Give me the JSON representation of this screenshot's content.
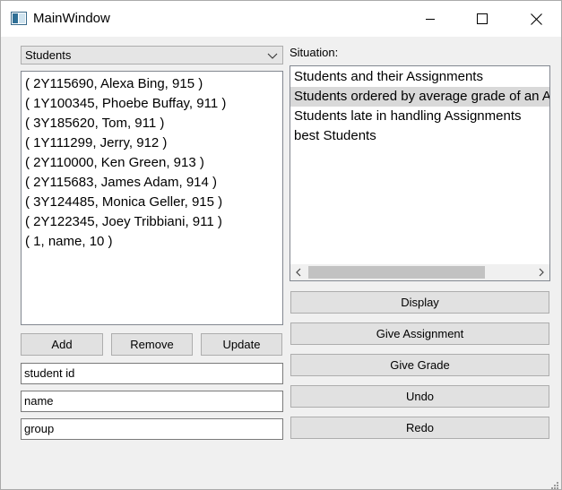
{
  "window": {
    "title": "MainWindow"
  },
  "combo": {
    "selected": "Students"
  },
  "students": [
    "( 2Y115690, Alexa Bing, 915 )",
    "( 1Y100345, Phoebe Buffay, 911 )",
    "( 3Y185620, Tom, 911 )",
    "( 1Y111299, Jerry, 912 )",
    "( 2Y110000, Ken Green, 913 )",
    "( 2Y115683, James Adam, 914 )",
    "( 3Y124485, Monica Geller, 915 )",
    "( 2Y122345, Joey Tribbiani, 911 )",
    "( 1, name, 10 )"
  ],
  "buttons": {
    "add": "Add",
    "remove": "Remove",
    "update": "Update",
    "display": "Display",
    "give_assignment": "Give Assignment",
    "give_grade": "Give Grade",
    "undo": "Undo",
    "redo": "Redo"
  },
  "fields": {
    "student_id": "student id",
    "name": "name",
    "group": "group"
  },
  "situation": {
    "label": "Situation:",
    "items": [
      "Students and their Assignments",
      "Students ordered by average grade of an Assignment",
      "Students late in handling Assignments",
      "best Students"
    ],
    "selected_index": 1
  },
  "colors": {
    "selection": "#d9d9d9",
    "button_bg": "#e1e1e1",
    "window_bg": "#f0f0f0"
  }
}
